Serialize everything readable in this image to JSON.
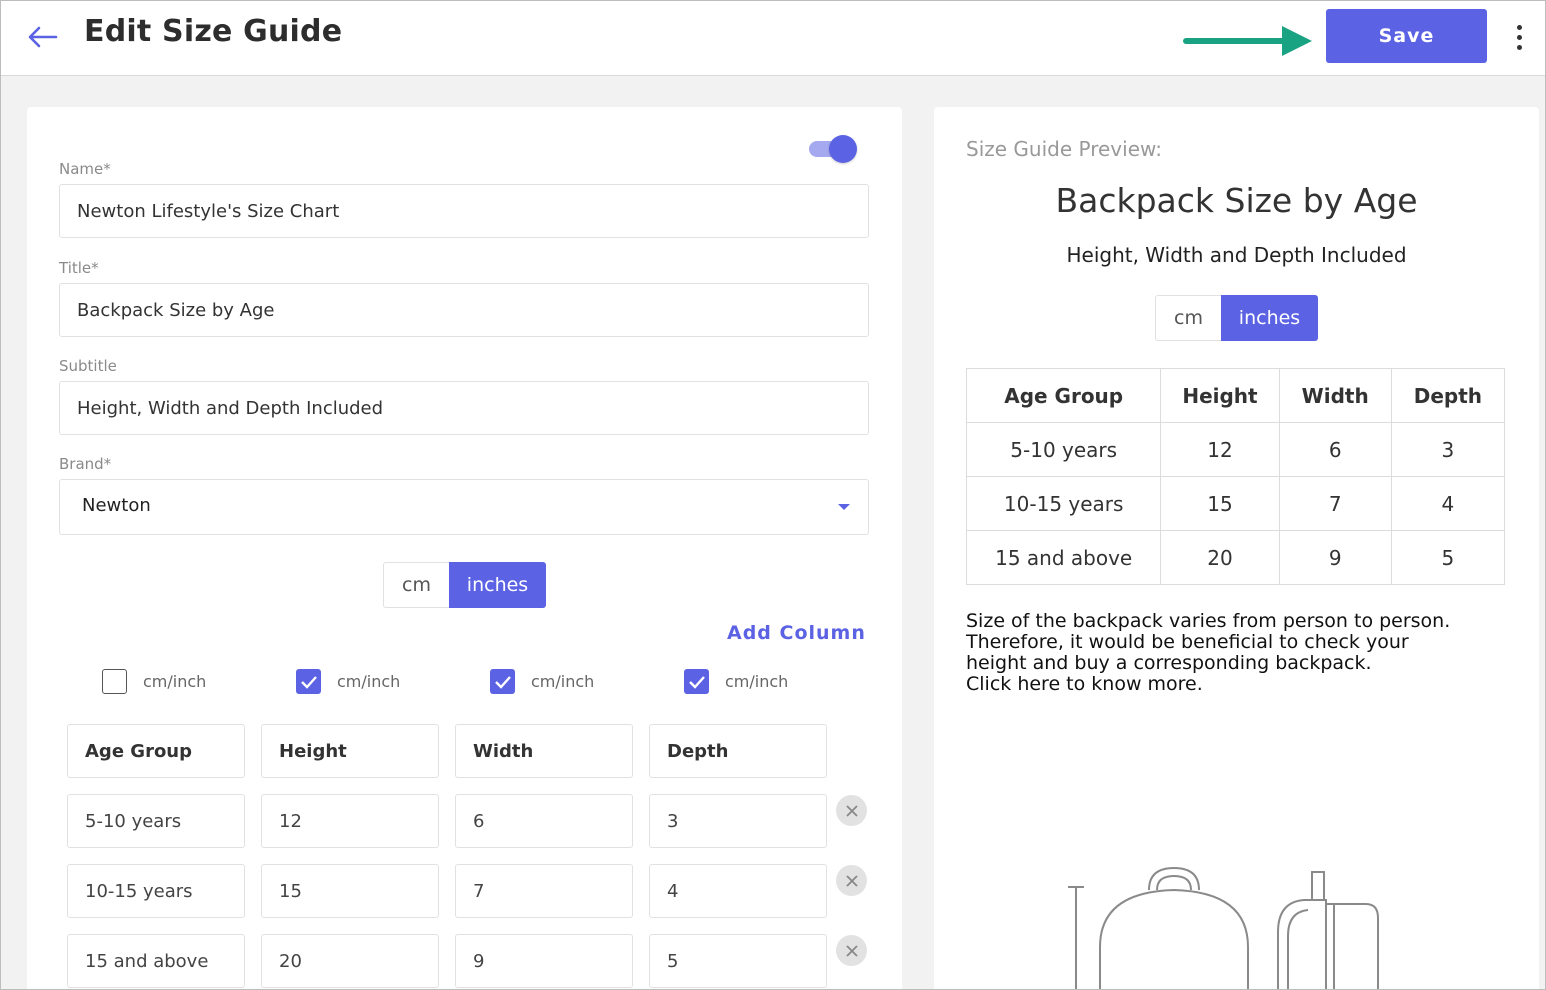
{
  "header": {
    "title": "Edit Size Guide",
    "save_label": "Save"
  },
  "form": {
    "name_label": "Name*",
    "name_value": "Newton Lifestyle's Size Chart",
    "title_label": "Title*",
    "title_value": "Backpack Size by Age",
    "subtitle_label": "Subtitle",
    "subtitle_value": "Height, Width and Depth Included",
    "brand_label": "Brand*",
    "brand_value": "Newton",
    "enabled": true
  },
  "units": {
    "cm": "cm",
    "inches": "inches",
    "selected": "inches"
  },
  "columns": {
    "add_label": "Add Column",
    "unit_toggles": [
      {
        "label": "cm/inch",
        "checked": false
      },
      {
        "label": "cm/inch",
        "checked": true
      },
      {
        "label": "cm/inch",
        "checked": true
      },
      {
        "label": "cm/inch",
        "checked": true
      }
    ],
    "headers": [
      "Age Group",
      "Height",
      "Width",
      "Depth"
    ],
    "rows": [
      [
        "5-10 years",
        "12",
        "6",
        "3"
      ],
      [
        "10-15 years",
        "15",
        "7",
        "4"
      ],
      [
        "15 and above",
        "20",
        "9",
        "5"
      ]
    ]
  },
  "preview": {
    "label": "Size Guide Preview:",
    "title": "Backpack Size by Age",
    "subtitle": "Height, Width and Depth Included",
    "note_lines": [
      "Size of the backpack varies from person to person.",
      "Therefore, it would be beneficial to check your",
      "height and buy a corresponding backpack.",
      "Click here to know more."
    ]
  },
  "colors": {
    "accent": "#5b62e3",
    "annotation_arrow": "#1aa382"
  },
  "icons": {
    "back": "arrow-left-icon",
    "more": "more-vertical-icon",
    "remove": "close-icon",
    "check": "checkmark-icon",
    "caret": "chevron-down-icon"
  }
}
